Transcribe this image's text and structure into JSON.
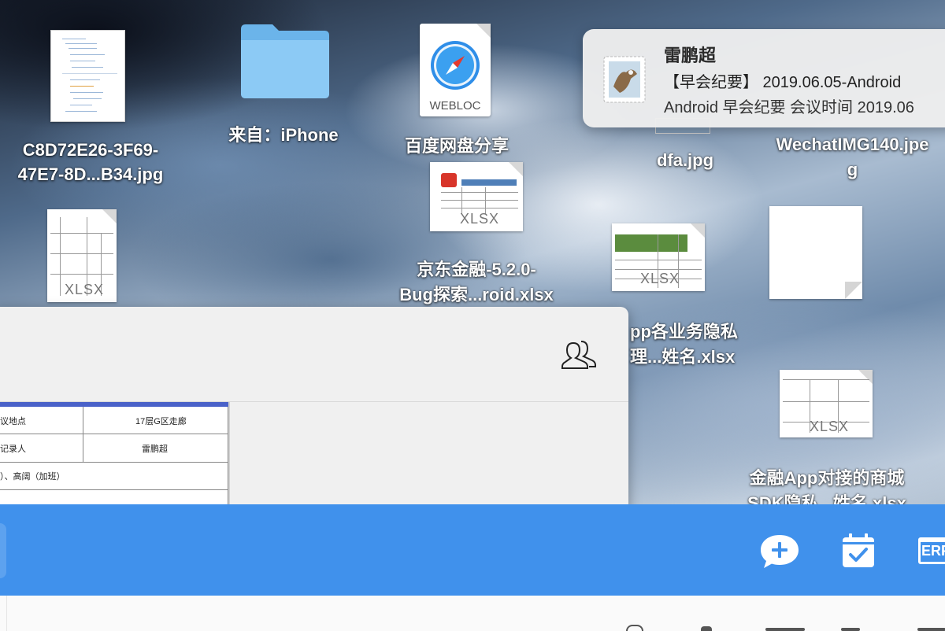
{
  "desktop": {
    "icons": [
      {
        "label_line1": "C8D72E26-3F69-",
        "label_line2": "47E7-8D...B34.jpg"
      },
      {
        "label_line1": "来自：iPhone"
      },
      {
        "label_line1": "百度网盘分享",
        "badge": "WEBLOC"
      },
      {
        "label_line1": "dfa.jpg"
      },
      {
        "label_line1": "WechatIMG140.jpe",
        "label_line2": "g"
      },
      {
        "label_line1": "京东金融-5.2.0-",
        "label_line2": "Bug探索...roid.xlsx",
        "badge": "XLSX"
      },
      {
        "badge": "XLSX"
      },
      {
        "badge": "XLSX"
      },
      {
        "label_line1": "pp各业务隐私",
        "label_line2": "理...姓名.xlsx"
      },
      {
        "label_line1": "金融App对接的商城",
        "label_line2": "SDK隐私...姓名.xlsx",
        "badge": "XLSX"
      }
    ]
  },
  "notification": {
    "app_icon": "mail-stamp-icon",
    "sender": "雷鹏超",
    "subject": "【早会纪要】 2019.06.05-Android",
    "preview": "Android 早会纪要 会议时间 2019.06"
  },
  "window": {
    "toolbar_icon": "contacts-icon",
    "preview": {
      "cells": {
        "r1c1": "议地点",
        "r1c2": "17层G区走廊",
        "r2c1": "记录人",
        "r2c2": "雷鹏超",
        "r3c1": "）、高阔（加班）"
      }
    }
  },
  "dock": {
    "icons": [
      "chat-add-icon",
      "calendar-check-icon",
      "erp-icon"
    ],
    "erp_label": "ERP"
  },
  "colors": {
    "dock_blue": "#4091ec",
    "preview_accent": "#4a62c9"
  }
}
